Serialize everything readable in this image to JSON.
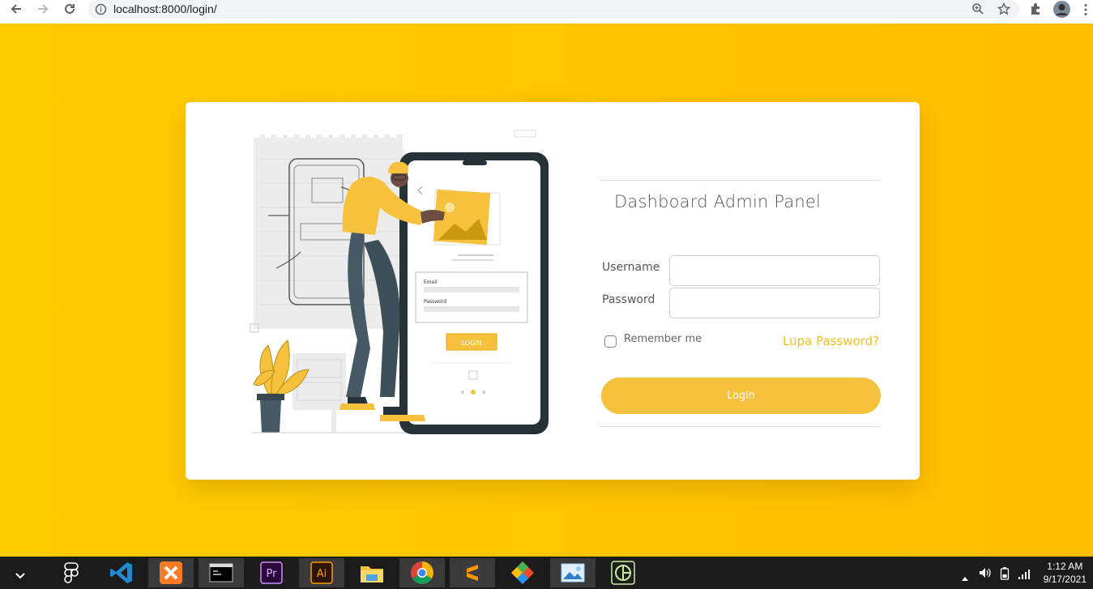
{
  "browser": {
    "url": "localhost:8000/login/"
  },
  "illustration": {
    "email_label": "Email",
    "password_label": "Password",
    "login_label": "LOGIN"
  },
  "login": {
    "title": "Dashboard Admin Panel",
    "username_label": "Username",
    "password_label": "Password",
    "username_value": "",
    "password_value": "",
    "remember_label": "Remember me",
    "forgot_label": "Lupa Password?",
    "submit_label": "Login"
  },
  "taskbar": {
    "apps": [
      "figma-icon",
      "vscode-icon",
      "xampp-icon",
      "terminal-icon",
      "premiere-icon",
      "illustrator-icon",
      "file-explorer-icon",
      "chrome-icon",
      "sublime-icon",
      "git-icon",
      "photos-icon",
      "app-icon"
    ],
    "time": "1:12 AM",
    "date": "9/17/2021"
  },
  "colors": {
    "background": "#ffc400",
    "accent": "#f6c23e",
    "link": "#f2c01e"
  }
}
